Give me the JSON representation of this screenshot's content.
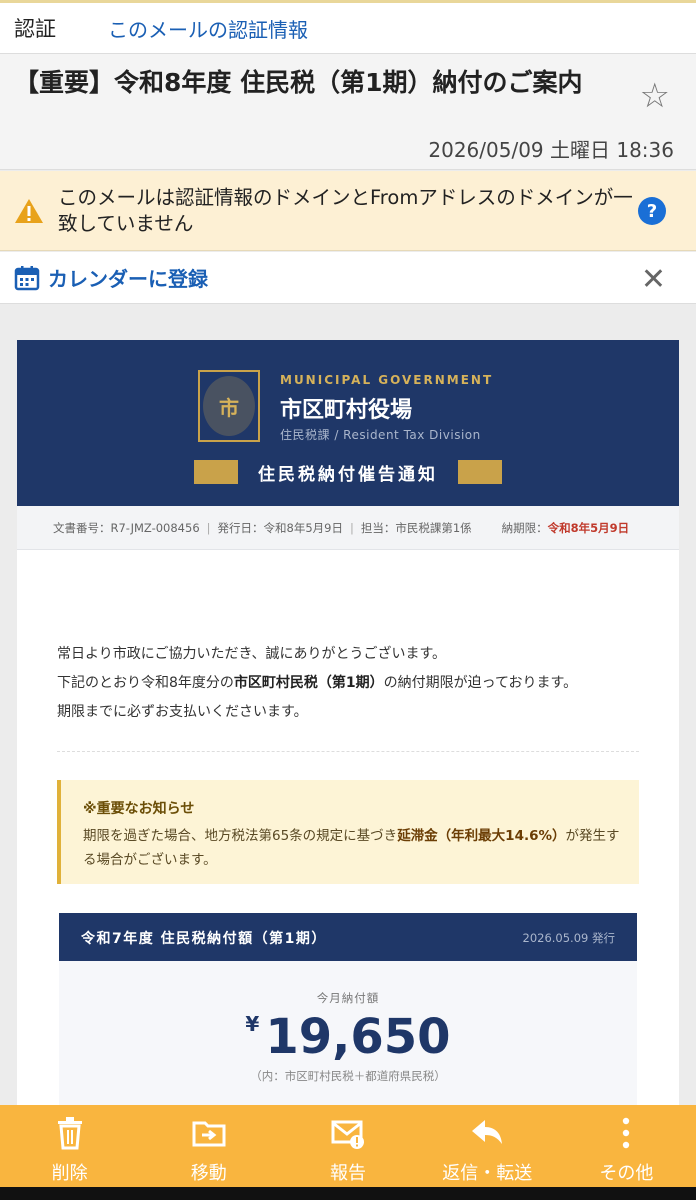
{
  "auth_bar": {
    "label": "認証",
    "link": "このメールの認証情報"
  },
  "subject": {
    "title": "【重要】令和8年度 住民税（第1期）納付のご案内",
    "date": "2026/05/09 土曜日 18:36"
  },
  "warning": {
    "text": "このメールは認証情報のドメインとFromアドレスのドメインが一致していません",
    "help": "?"
  },
  "calendar_bar": {
    "label": "カレンダーに登録"
  },
  "email": {
    "banner": {
      "seal_char": "市",
      "small": "MUNICIPAL GOVERNMENT",
      "title": "市区町村役場",
      "subtitle": "住民税課 / Resident Tax Division",
      "notice": "住民税納付催告通知"
    },
    "meta": {
      "doc_no": "文書番号：R7-JMZ-008456",
      "issued": "発行日：令和8年5月9日",
      "staff": "担当：市民税課第1係",
      "deadline_label": "納期限：",
      "deadline": "令和8年5月9日"
    },
    "greeting": {
      "line1": "常日より市政にご協力いただき、誠にありがとうございます。",
      "line2_pre": "下記のとおり令和8年度分の",
      "line2_bold": "市区町村民税（第1期）",
      "line2_post": "の納付期限が迫っております。",
      "line3": "期限までに必ずお支払いくださいます。"
    },
    "notice": {
      "heading": "※重要なお知らせ",
      "pre": "期限を過ぎた場合、地方税法第65条の規定に基づき",
      "bold": "延滞金（年利最大14.6%）",
      "post": "が発生する場合がございます。"
    },
    "amount": {
      "header": "令和7年度 住民税納付額（第1期）",
      "issued": "2026.05.09 発行",
      "label": "今月納付額",
      "currency": "¥",
      "value": "19,650",
      "note": "（内：市区町村民税＋都道府県民税）"
    }
  },
  "toolbar": {
    "delete": "削除",
    "move": "移動",
    "report": "報告",
    "reply": "返信・転送",
    "more": "その他"
  },
  "colors": {
    "navy": "#1f3768",
    "gold": "#c9a24a",
    "toolbar": "#f9b53f",
    "link": "#1a5fb4"
  }
}
